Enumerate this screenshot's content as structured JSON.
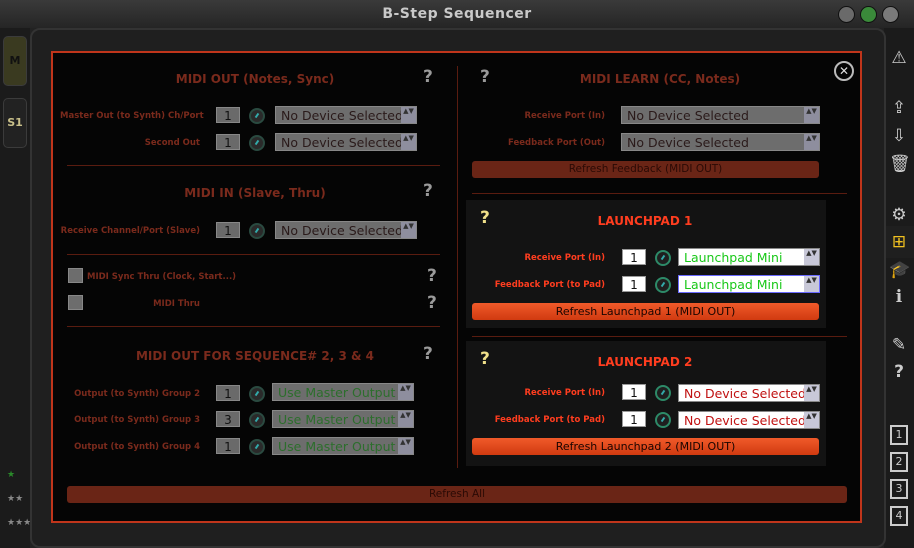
{
  "window": {
    "title": "B-Step Sequencer"
  },
  "left_rail": {
    "btn1": "M",
    "btn2": "S1",
    "stars1": "★",
    "stars2": "★★",
    "stars3": "★★★"
  },
  "dialog": {
    "close": "✕",
    "help": "?",
    "midi_out": {
      "title": "MIDI OUT (Notes, Sync)",
      "master_label": "Master Out (to Synth) Ch/Port",
      "master_channel": "1",
      "master_device": "No Device Selected",
      "second_label": "Second Out",
      "second_channel": "1",
      "second_device": "No Device Selected"
    },
    "midi_in": {
      "title": "MIDI IN (Slave, Thru)",
      "receive_label": "Receive Channel/Port (Slave)",
      "receive_channel": "1",
      "receive_device": "No Device Selected"
    },
    "sync": {
      "sync_thru_label": "MIDI Sync Thru (Clock, Start...)",
      "midi_thru_label": "MIDI Thru"
    },
    "seq_out": {
      "title": "MIDI OUT FOR SEQUENCE# 2, 3 & 4",
      "groups": [
        {
          "label": "Output (to Synth) Group 2",
          "channel": "1",
          "device": "Use Master Output"
        },
        {
          "label": "Output (to Synth) Group 3",
          "channel": "3",
          "device": "Use Master Output"
        },
        {
          "label": "Output (to Synth) Group 4",
          "channel": "1",
          "device": "Use Master Output"
        }
      ]
    },
    "midi_learn": {
      "title": "MIDI LEARN (CC, Notes)",
      "receive_label": "Receive Port (In)",
      "receive_device": "No Device Selected",
      "feedback_label": "Feedback Port (Out)",
      "feedback_device": "No Device Selected",
      "refresh": "Refresh Feedback (MIDI OUT)"
    },
    "launchpad1": {
      "title": "LAUNCHPAD 1",
      "receive_label": "Receive Port (In)",
      "receive_channel": "1",
      "receive_device": "Launchpad Mini",
      "feedback_label": "Feedback Port (to Pad)",
      "feedback_channel": "1",
      "feedback_device": "Launchpad Mini",
      "refresh": "Refresh Launchpad 1 (MIDI OUT)"
    },
    "launchpad2": {
      "title": "LAUNCHPAD 2",
      "receive_label": "Receive Port (In)",
      "receive_channel": "1",
      "receive_device": "No Device Selected",
      "feedback_label": "Feedback Port (to Pad)",
      "feedback_channel": "1",
      "feedback_device": "No Device Selected",
      "refresh": "Refresh Launchpad 2 (MIDI OUT)"
    },
    "refresh_all": "Refresh All"
  },
  "right_rail": {
    "warning": "⚠",
    "export": "⇪",
    "import": "⇩",
    "trash": "🗑",
    "settings": "⚙",
    "midi": "⊞",
    "learn": "🎓",
    "info": "i",
    "eraser": "✎",
    "help": "?",
    "slots": [
      "1",
      "2",
      "3",
      "4"
    ]
  },
  "colors": {
    "accent": "#ff3d1f",
    "frame": "#c0351b",
    "dim": "#7a2a1c"
  },
  "arrows": "▲▼"
}
